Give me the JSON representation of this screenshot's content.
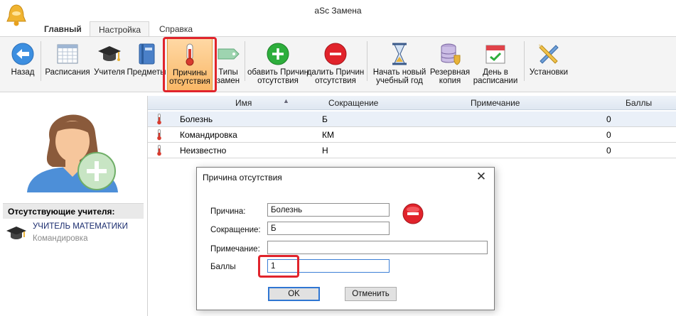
{
  "window": {
    "title": "aSc Замена"
  },
  "tabs": [
    {
      "label": "Главный"
    },
    {
      "label": "Настройка"
    },
    {
      "label": "Справка"
    }
  ],
  "ribbon": {
    "back": "Назад",
    "timetables": "Расписания",
    "teachers": "Учителя",
    "subjects": "Предметы",
    "absence_reasons": "Причины\nотсутствия",
    "substitution_types": "Типы\nзамен",
    "add_reason": "обавить Причин\nотсутствия",
    "delete_reason": "далить Причин\nотсутствия",
    "new_year": "Начать новый\nучебный год",
    "backup": "Резервная\nкопия",
    "day_in_timetable": "День в\nрасписании",
    "settings": "Установки"
  },
  "left_panel": {
    "absent_header": "Отсутствующие учителя:",
    "teacher_name": "УЧИТЕЛЬ МАТЕМАТИКИ",
    "teacher_reason": "Командировка"
  },
  "table": {
    "columns": [
      "Имя",
      "Сокращение",
      "Примечание",
      "Баллы"
    ],
    "rows": [
      {
        "name": "Болезнь",
        "short": "Б",
        "note": "",
        "points": "0"
      },
      {
        "name": "Командировка",
        "short": "КМ",
        "note": "",
        "points": "0"
      },
      {
        "name": "Неизвестно",
        "short": "Н",
        "note": "",
        "points": "0"
      }
    ]
  },
  "dialog": {
    "title": "Причина отсутствия",
    "close": "✕",
    "labels": {
      "reason": "Причина:",
      "short": "Сокращение:",
      "note": "Примечание:",
      "points": "Баллы"
    },
    "values": {
      "reason": "Болезнь",
      "short": "Б",
      "note": "",
      "points": "1"
    },
    "ok": "OK",
    "cancel": "Отменить"
  },
  "colors": {
    "highlight": "#e0242c",
    "ribbon_bg": "#f4f4f4",
    "selected_row": "#eaf0f8",
    "header_bg": "#dfe7f1"
  }
}
